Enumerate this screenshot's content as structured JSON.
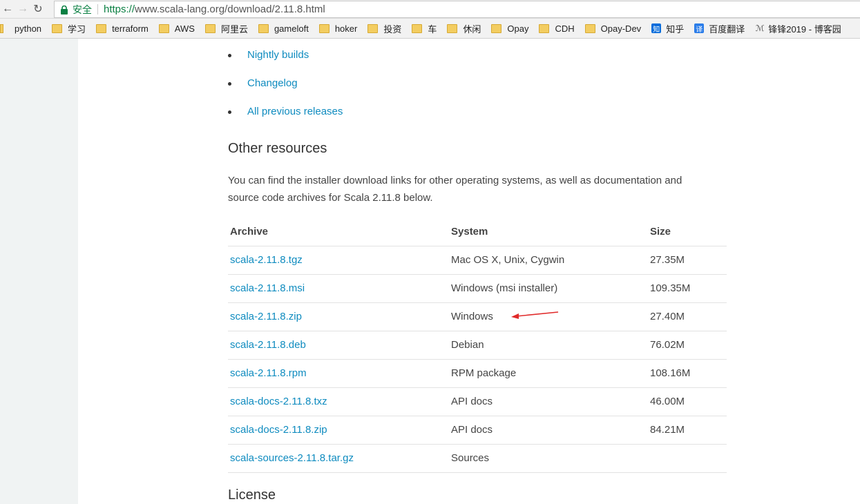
{
  "browser": {
    "secure_label": "安全",
    "url_protocol": "https://",
    "url_rest": "www.scala-lang.org/download/2.11.8.html",
    "back_icon": "←",
    "forward_icon": "→",
    "reload_icon": "↻"
  },
  "bookmarks": [
    {
      "label": "python",
      "type": "folder"
    },
    {
      "label": "学习",
      "type": "folder"
    },
    {
      "label": "terraform",
      "type": "folder"
    },
    {
      "label": "AWS",
      "type": "folder"
    },
    {
      "label": "阿里云",
      "type": "folder"
    },
    {
      "label": "gameloft",
      "type": "folder"
    },
    {
      "label": "hoker",
      "type": "folder"
    },
    {
      "label": "投资",
      "type": "folder"
    },
    {
      "label": "车",
      "type": "folder"
    },
    {
      "label": "休闲",
      "type": "folder"
    },
    {
      "label": "Opay",
      "type": "folder"
    },
    {
      "label": "CDH",
      "type": "folder"
    },
    {
      "label": "Opay-Dev",
      "type": "folder"
    },
    {
      "label": "知乎",
      "type": "zhihu",
      "icon_text": "知"
    },
    {
      "label": "百度翻译",
      "type": "fanyi",
      "icon_text": "译"
    },
    {
      "label": "锋锋2019 - 博客园",
      "type": "cnblogs",
      "icon_text": "ℳ"
    }
  ],
  "links": [
    {
      "label": "Nightly builds"
    },
    {
      "label": "Changelog"
    },
    {
      "label": "All previous releases"
    }
  ],
  "other_resources": {
    "heading": "Other resources",
    "intro_line1": "You can find the installer download links for other operating systems, as well as documentation and",
    "intro_line2": "source code archives for Scala 2.11.8 below."
  },
  "table": {
    "headers": {
      "archive": "Archive",
      "system": "System",
      "size": "Size"
    },
    "rows": [
      {
        "archive": "scala-2.11.8.tgz",
        "system": "Mac OS X, Unix, Cygwin",
        "size": "27.35M"
      },
      {
        "archive": "scala-2.11.8.msi",
        "system": "Windows (msi installer)",
        "size": "109.35M"
      },
      {
        "archive": "scala-2.11.8.zip",
        "system": "Windows",
        "size": "27.40M"
      },
      {
        "archive": "scala-2.11.8.deb",
        "system": "Debian",
        "size": "76.02M"
      },
      {
        "archive": "scala-2.11.8.rpm",
        "system": "RPM package",
        "size": "108.16M"
      },
      {
        "archive": "scala-docs-2.11.8.txz",
        "system": "API docs",
        "size": "46.00M"
      },
      {
        "archive": "scala-docs-2.11.8.zip",
        "system": "API docs",
        "size": "84.21M"
      },
      {
        "archive": "scala-sources-2.11.8.tar.gz",
        "system": "Sources",
        "size": ""
      }
    ]
  },
  "license_heading": "License",
  "colors": {
    "link": "#0e8bbf",
    "secure": "#0b8043",
    "arrow": "#e02a2a",
    "sidebar": "#f0f3f3"
  }
}
